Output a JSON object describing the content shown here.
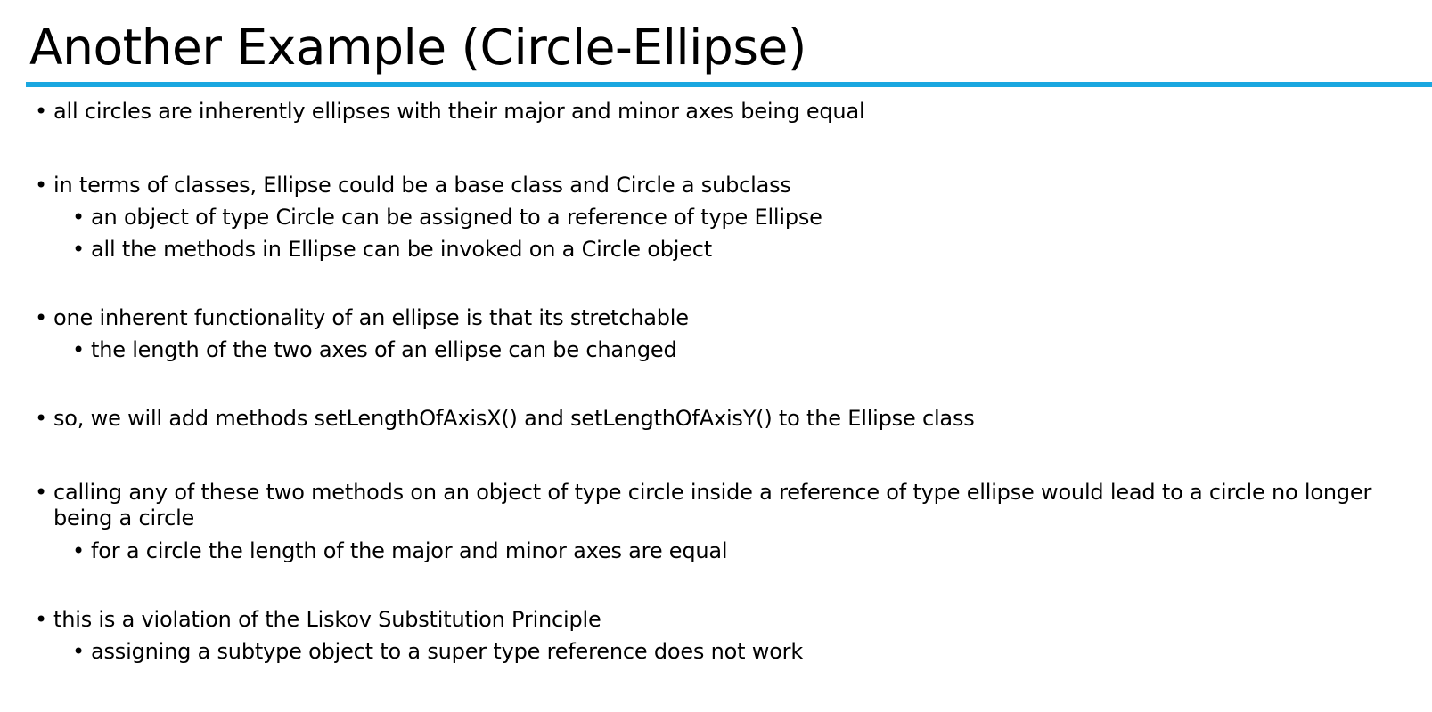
{
  "title": "Another Example (Circle-Ellipse)",
  "bullet_glyph": "•",
  "accent_color": "#1aa7e0",
  "groups": [
    {
      "text": "all circles are inherently ellipses with their major and minor axes being equal",
      "subitems": []
    },
    {
      "text": "in terms of classes, Ellipse could be a base class and Circle a subclass",
      "subitems": [
        "an object of type Circle can be assigned to a reference of type Ellipse",
        "all the methods in Ellipse can be invoked on a Circle object"
      ]
    },
    {
      "text": "one inherent functionality of an ellipse is that its stretchable",
      "subitems": [
        "the length of the two axes of an ellipse can be changed"
      ]
    },
    {
      "text": "so, we will add methods setLengthOfAxisX() and setLengthOfAxisY() to the Ellipse class",
      "subitems": []
    },
    {
      "text": "calling any of these two methods on an object of type circle inside a reference of type ellipse would lead to a circle no longer being a circle",
      "subitems": [
        "for a circle the length of the major and minor axes are equal"
      ]
    },
    {
      "text": "this is a violation of the Liskov Substitution Principle",
      "subitems": [
        "assigning a subtype object to a super type reference does not work"
      ]
    }
  ]
}
